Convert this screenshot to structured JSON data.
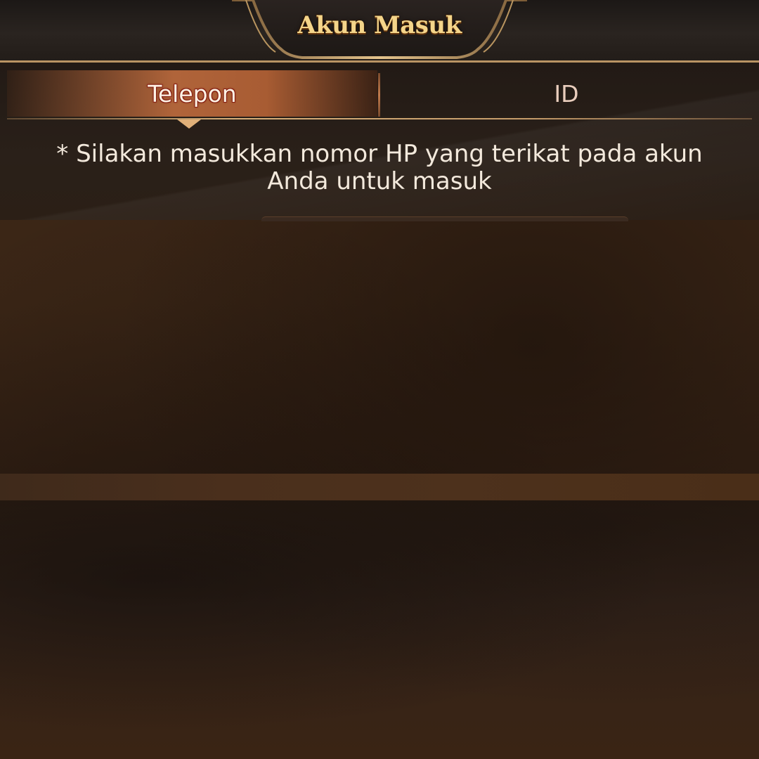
{
  "header": {
    "title": "Akun Masuk"
  },
  "tabs": [
    {
      "label": "Telepon",
      "active": true
    },
    {
      "label": "ID",
      "active": false
    }
  ],
  "instruction": {
    "text": "* Silakan masukkan nomor HP yang terikat pada akun Anda untuk masuk"
  },
  "colors": {
    "title_gold": "#f4d58a",
    "tab_active_bg": "#b0643a",
    "accent_line": "#d8b07a",
    "text_light": "#f3e9dc"
  }
}
